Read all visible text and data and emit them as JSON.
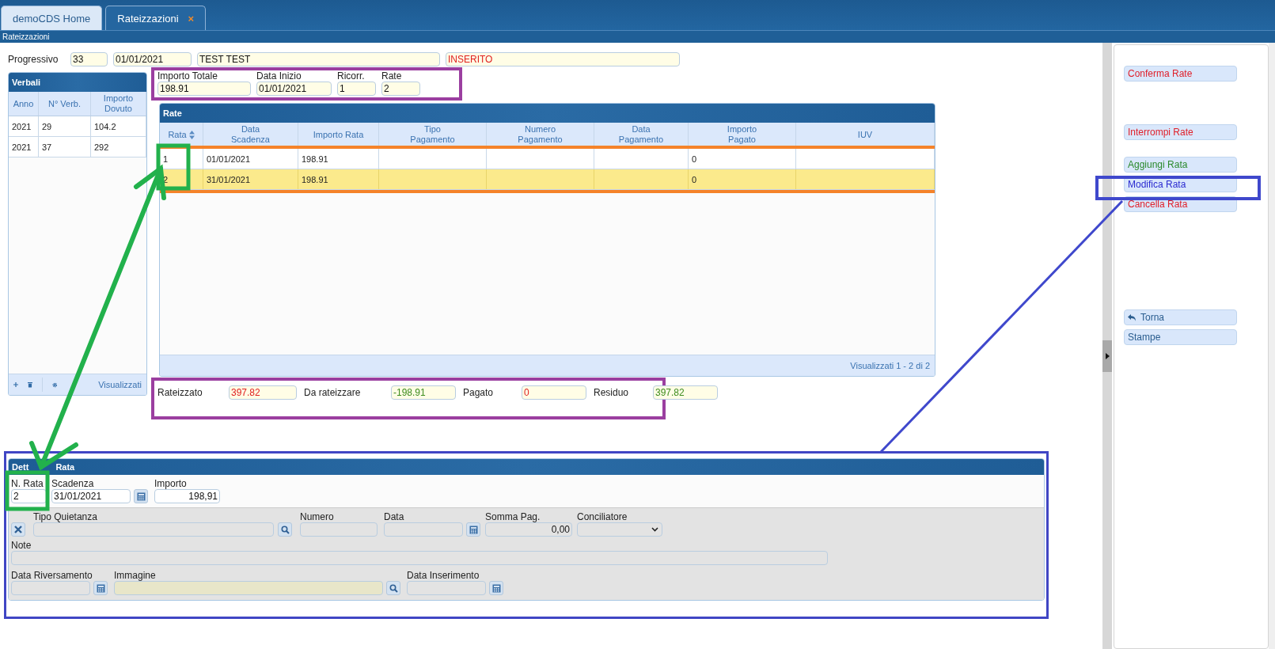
{
  "tabs": [
    {
      "label": "demoCDS Home",
      "selected": false
    },
    {
      "label": "Rateizzazioni",
      "selected": true,
      "close": "×"
    }
  ],
  "breadcrumb": "Rateizzazioni",
  "header": {
    "label": "Progressivo",
    "number": "33",
    "date": "01/01/2021",
    "name": "TEST TEST",
    "status": "INSERITO"
  },
  "verbali": {
    "title": "Verbali",
    "columns": [
      "Anno",
      "N° Verb.",
      "Importo Dovuto"
    ],
    "rows": [
      [
        "2021",
        "29",
        "104.2"
      ],
      [
        "2021",
        "37",
        "292"
      ]
    ],
    "footer": "Visualizzati"
  },
  "params": [
    {
      "label": "Importo Totale",
      "value": "198.91"
    },
    {
      "label": "Data Inizio",
      "value": "01/01/2021"
    },
    {
      "label": "Ricorr.",
      "value": "1"
    },
    {
      "label": "Rate",
      "value": "2"
    }
  ],
  "rate": {
    "title": "Rate",
    "columns": [
      "Rata",
      "Data Scadenza",
      "Importo Rata",
      "Tipo Pagamento",
      "Numero Pagamento",
      "Data Pagamento",
      "Importo Pagato",
      "IUV"
    ],
    "rows": [
      {
        "rata": "1",
        "data_scadenza": "01/01/2021",
        "importo_rata": "198.91",
        "importo_pagato": "0",
        "selected": false
      },
      {
        "rata": "2",
        "data_scadenza": "31/01/2021",
        "importo_rata": "198.91",
        "importo_pagato": "0",
        "selected": true
      }
    ],
    "footer": "Visualizzati 1 - 2 di 2"
  },
  "totals": [
    {
      "label": "Rateizzato",
      "value": "397.82",
      "color": "#e02020"
    },
    {
      "label": "Da rateizzare",
      "value": "-198.91",
      "color": "#3c8c1e"
    },
    {
      "label": "Pagato",
      "value": "0",
      "color": "#e02020"
    },
    {
      "label": "Residuo",
      "value": "397.82",
      "color": "#3c8c1e"
    }
  ],
  "detail": {
    "title": [
      "Dett",
      "Rata"
    ],
    "n_rata": {
      "label": "N. Rata",
      "value": "2"
    },
    "scadenza": {
      "label": "Scadenza",
      "value": "31/01/2021"
    },
    "importo": {
      "label": "Importo",
      "value": "198,91"
    },
    "tipo_quietanza": {
      "label": "Tipo Quietanza"
    },
    "numero": {
      "label": "Numero"
    },
    "data": {
      "label": "Data"
    },
    "somma_pag": {
      "label": "Somma Pag.",
      "value": "0,00"
    },
    "conciliatore": {
      "label": "Conciliatore"
    },
    "note": {
      "label": "Note"
    },
    "data_riversamento": {
      "label": "Data Riversamento"
    },
    "immagine": {
      "label": "Immagine"
    },
    "data_inserimento": {
      "label": "Data Inserimento"
    }
  },
  "actions": [
    [
      {
        "label": "Conferma Rate",
        "kind": "danger"
      }
    ],
    [
      {
        "label": "Interrompi Rate",
        "kind": "danger"
      }
    ],
    [
      {
        "label": "Aggiungi Rata",
        "kind": "success"
      },
      {
        "label": "Modifica Rata",
        "kind": "primary"
      },
      {
        "label": "Cancella Rata",
        "kind": "danger"
      }
    ],
    [
      {
        "label": "Torna",
        "kind": "back"
      },
      {
        "label": "Stampe",
        "kind": "plain"
      }
    ]
  ]
}
